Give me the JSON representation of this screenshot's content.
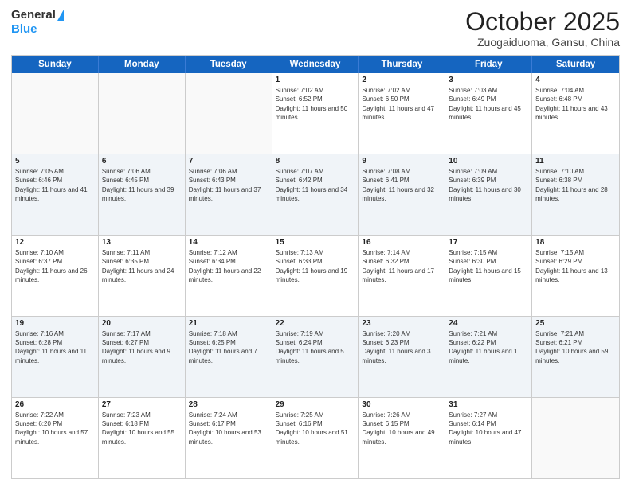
{
  "logo": {
    "general": "General",
    "blue": "Blue"
  },
  "title": "October 2025",
  "location": "Zuogaiduoma, Gansu, China",
  "days_of_week": [
    "Sunday",
    "Monday",
    "Tuesday",
    "Wednesday",
    "Thursday",
    "Friday",
    "Saturday"
  ],
  "weeks": [
    [
      {
        "day": "",
        "sunrise": "",
        "sunset": "",
        "daylight": ""
      },
      {
        "day": "",
        "sunrise": "",
        "sunset": "",
        "daylight": ""
      },
      {
        "day": "",
        "sunrise": "",
        "sunset": "",
        "daylight": ""
      },
      {
        "day": "1",
        "sunrise": "Sunrise: 7:02 AM",
        "sunset": "Sunset: 6:52 PM",
        "daylight": "Daylight: 11 hours and 50 minutes."
      },
      {
        "day": "2",
        "sunrise": "Sunrise: 7:02 AM",
        "sunset": "Sunset: 6:50 PM",
        "daylight": "Daylight: 11 hours and 47 minutes."
      },
      {
        "day": "3",
        "sunrise": "Sunrise: 7:03 AM",
        "sunset": "Sunset: 6:49 PM",
        "daylight": "Daylight: 11 hours and 45 minutes."
      },
      {
        "day": "4",
        "sunrise": "Sunrise: 7:04 AM",
        "sunset": "Sunset: 6:48 PM",
        "daylight": "Daylight: 11 hours and 43 minutes."
      }
    ],
    [
      {
        "day": "5",
        "sunrise": "Sunrise: 7:05 AM",
        "sunset": "Sunset: 6:46 PM",
        "daylight": "Daylight: 11 hours and 41 minutes."
      },
      {
        "day": "6",
        "sunrise": "Sunrise: 7:06 AM",
        "sunset": "Sunset: 6:45 PM",
        "daylight": "Daylight: 11 hours and 39 minutes."
      },
      {
        "day": "7",
        "sunrise": "Sunrise: 7:06 AM",
        "sunset": "Sunset: 6:43 PM",
        "daylight": "Daylight: 11 hours and 37 minutes."
      },
      {
        "day": "8",
        "sunrise": "Sunrise: 7:07 AM",
        "sunset": "Sunset: 6:42 PM",
        "daylight": "Daylight: 11 hours and 34 minutes."
      },
      {
        "day": "9",
        "sunrise": "Sunrise: 7:08 AM",
        "sunset": "Sunset: 6:41 PM",
        "daylight": "Daylight: 11 hours and 32 minutes."
      },
      {
        "day": "10",
        "sunrise": "Sunrise: 7:09 AM",
        "sunset": "Sunset: 6:39 PM",
        "daylight": "Daylight: 11 hours and 30 minutes."
      },
      {
        "day": "11",
        "sunrise": "Sunrise: 7:10 AM",
        "sunset": "Sunset: 6:38 PM",
        "daylight": "Daylight: 11 hours and 28 minutes."
      }
    ],
    [
      {
        "day": "12",
        "sunrise": "Sunrise: 7:10 AM",
        "sunset": "Sunset: 6:37 PM",
        "daylight": "Daylight: 11 hours and 26 minutes."
      },
      {
        "day": "13",
        "sunrise": "Sunrise: 7:11 AM",
        "sunset": "Sunset: 6:35 PM",
        "daylight": "Daylight: 11 hours and 24 minutes."
      },
      {
        "day": "14",
        "sunrise": "Sunrise: 7:12 AM",
        "sunset": "Sunset: 6:34 PM",
        "daylight": "Daylight: 11 hours and 22 minutes."
      },
      {
        "day": "15",
        "sunrise": "Sunrise: 7:13 AM",
        "sunset": "Sunset: 6:33 PM",
        "daylight": "Daylight: 11 hours and 19 minutes."
      },
      {
        "day": "16",
        "sunrise": "Sunrise: 7:14 AM",
        "sunset": "Sunset: 6:32 PM",
        "daylight": "Daylight: 11 hours and 17 minutes."
      },
      {
        "day": "17",
        "sunrise": "Sunrise: 7:15 AM",
        "sunset": "Sunset: 6:30 PM",
        "daylight": "Daylight: 11 hours and 15 minutes."
      },
      {
        "day": "18",
        "sunrise": "Sunrise: 7:15 AM",
        "sunset": "Sunset: 6:29 PM",
        "daylight": "Daylight: 11 hours and 13 minutes."
      }
    ],
    [
      {
        "day": "19",
        "sunrise": "Sunrise: 7:16 AM",
        "sunset": "Sunset: 6:28 PM",
        "daylight": "Daylight: 11 hours and 11 minutes."
      },
      {
        "day": "20",
        "sunrise": "Sunrise: 7:17 AM",
        "sunset": "Sunset: 6:27 PM",
        "daylight": "Daylight: 11 hours and 9 minutes."
      },
      {
        "day": "21",
        "sunrise": "Sunrise: 7:18 AM",
        "sunset": "Sunset: 6:25 PM",
        "daylight": "Daylight: 11 hours and 7 minutes."
      },
      {
        "day": "22",
        "sunrise": "Sunrise: 7:19 AM",
        "sunset": "Sunset: 6:24 PM",
        "daylight": "Daylight: 11 hours and 5 minutes."
      },
      {
        "day": "23",
        "sunrise": "Sunrise: 7:20 AM",
        "sunset": "Sunset: 6:23 PM",
        "daylight": "Daylight: 11 hours and 3 minutes."
      },
      {
        "day": "24",
        "sunrise": "Sunrise: 7:21 AM",
        "sunset": "Sunset: 6:22 PM",
        "daylight": "Daylight: 11 hours and 1 minute."
      },
      {
        "day": "25",
        "sunrise": "Sunrise: 7:21 AM",
        "sunset": "Sunset: 6:21 PM",
        "daylight": "Daylight: 10 hours and 59 minutes."
      }
    ],
    [
      {
        "day": "26",
        "sunrise": "Sunrise: 7:22 AM",
        "sunset": "Sunset: 6:20 PM",
        "daylight": "Daylight: 10 hours and 57 minutes."
      },
      {
        "day": "27",
        "sunrise": "Sunrise: 7:23 AM",
        "sunset": "Sunset: 6:18 PM",
        "daylight": "Daylight: 10 hours and 55 minutes."
      },
      {
        "day": "28",
        "sunrise": "Sunrise: 7:24 AM",
        "sunset": "Sunset: 6:17 PM",
        "daylight": "Daylight: 10 hours and 53 minutes."
      },
      {
        "day": "29",
        "sunrise": "Sunrise: 7:25 AM",
        "sunset": "Sunset: 6:16 PM",
        "daylight": "Daylight: 10 hours and 51 minutes."
      },
      {
        "day": "30",
        "sunrise": "Sunrise: 7:26 AM",
        "sunset": "Sunset: 6:15 PM",
        "daylight": "Daylight: 10 hours and 49 minutes."
      },
      {
        "day": "31",
        "sunrise": "Sunrise: 7:27 AM",
        "sunset": "Sunset: 6:14 PM",
        "daylight": "Daylight: 10 hours and 47 minutes."
      },
      {
        "day": "",
        "sunrise": "",
        "sunset": "",
        "daylight": ""
      }
    ]
  ]
}
